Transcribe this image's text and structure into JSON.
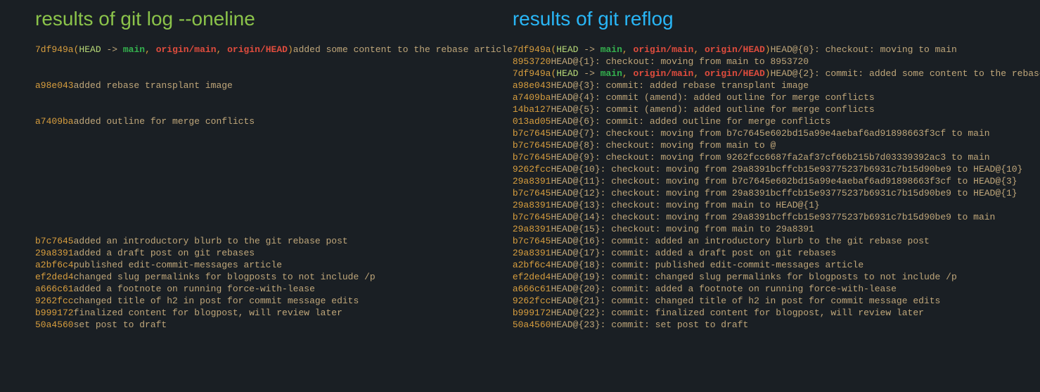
{
  "titles": {
    "left": "results of git log --oneline",
    "right": "results of git reflog"
  },
  "refs_full": {
    "open": "(",
    "head": "HEAD",
    "arrow": " -> ",
    "main": "main",
    "sep": ", ",
    "origin_main": "origin/main",
    "origin_head": "origin/HEAD",
    "close": ")"
  },
  "log": [
    {
      "hash": "7df949a",
      "msg": "added some content to the rebase article",
      "refs": true,
      "gap_after": "gap"
    },
    {
      "hash": "a98e043",
      "msg": "added rebase transplant image",
      "gap_after": "gap"
    },
    {
      "hash": "a7409ba",
      "msg": "added outline for merge conflicts",
      "gap_after": "gap-big"
    },
    {
      "hash": "b7c7645",
      "msg": "added an introductory blurb to the git rebase post"
    },
    {
      "hash": "29a8391",
      "msg": "added a draft post on git rebases"
    },
    {
      "hash": "a2bf6c4",
      "msg": "published edit-commit-messages article"
    },
    {
      "hash": "ef2ded4",
      "msg": "changed slug permalinks for blogposts to not include /p"
    },
    {
      "hash": "a666c61",
      "msg": "added a footnote on running force-with-lease"
    },
    {
      "hash": "9262fcc",
      "msg": "changed title of h2 in post for commit message edits"
    },
    {
      "hash": "b999172",
      "msg": "finalized content for blogpost, will review later"
    },
    {
      "hash": "50a4560",
      "msg": "set post to draft"
    }
  ],
  "reflog": [
    {
      "hash": "7df949a",
      "refs": true,
      "ref": "HEAD@{0}",
      "msg": "checkout: moving to main"
    },
    {
      "hash": "8953720",
      "ref": "HEAD@{1}",
      "msg": "checkout: moving from main to 8953720"
    },
    {
      "hash": "7df949a",
      "refs": true,
      "ref": "HEAD@{2}",
      "msg": "commit: added some content to the rebase article"
    },
    {
      "hash": "a98e043",
      "ref": "HEAD@{3}",
      "msg": "commit: added rebase transplant image"
    },
    {
      "hash": "a7409ba",
      "ref": "HEAD@{4}",
      "msg": "commit (amend): added outline for merge conflicts"
    },
    {
      "hash": "14ba127",
      "ref": "HEAD@{5}",
      "msg": "commit (amend): added outline for merge conflicts"
    },
    {
      "hash": "013ad05",
      "ref": "HEAD@{6}",
      "msg": "commit: added outline for merge conflicts"
    },
    {
      "hash": "b7c7645",
      "ref": "HEAD@{7}",
      "msg": "checkout: moving from b7c7645e602bd15a99e4aebaf6ad91898663f3cf to main"
    },
    {
      "hash": "b7c7645",
      "ref": "HEAD@{8}",
      "msg": "checkout: moving from main to @"
    },
    {
      "hash": "b7c7645",
      "ref": "HEAD@{9}",
      "msg": "checkout: moving from 9262fcc6687fa2af37cf66b215b7d03339392ac3 to main"
    },
    {
      "hash": "9262fcc",
      "ref": "HEAD@{10}",
      "msg": "checkout: moving from 29a8391bcffcb15e93775237b6931c7b15d90be9 to HEAD@{10}"
    },
    {
      "hash": "29a8391",
      "ref": "HEAD@{11}",
      "msg": "checkout: moving from b7c7645e602bd15a99e4aebaf6ad91898663f3cf to HEAD@{3}"
    },
    {
      "hash": "b7c7645",
      "ref": "HEAD@{12}",
      "msg": "checkout: moving from 29a8391bcffcb15e93775237b6931c7b15d90be9 to HEAD@{1}"
    },
    {
      "hash": "29a8391",
      "ref": "HEAD@{13}",
      "msg": "checkout: moving from main to HEAD@{1}"
    },
    {
      "hash": "b7c7645",
      "ref": "HEAD@{14}",
      "msg": "checkout: moving from 29a8391bcffcb15e93775237b6931c7b15d90be9 to main"
    },
    {
      "hash": "29a8391",
      "ref": "HEAD@{15}",
      "msg": "checkout: moving from main to 29a8391"
    },
    {
      "hash": "b7c7645",
      "ref": "HEAD@{16}",
      "msg": "commit: added an introductory blurb to the git rebase post"
    },
    {
      "hash": "29a8391",
      "ref": "HEAD@{17}",
      "msg": "commit: added a draft post on git rebases"
    },
    {
      "hash": "a2bf6c4",
      "ref": "HEAD@{18}",
      "msg": "commit: published edit-commit-messages article"
    },
    {
      "hash": "ef2ded4",
      "ref": "HEAD@{19}",
      "msg": "commit: changed slug permalinks for blogposts to not include /p"
    },
    {
      "hash": "a666c61",
      "ref": "HEAD@{20}",
      "msg": "commit: added a footnote on running force-with-lease"
    },
    {
      "hash": "9262fcc",
      "ref": "HEAD@{21}",
      "msg": "commit: changed title of h2 in post for commit message edits"
    },
    {
      "hash": "b999172",
      "ref": "HEAD@{22}",
      "msg": "commit: finalized content for blogpost, will review later"
    },
    {
      "hash": "50a4560",
      "ref": "HEAD@{23}",
      "msg": "commit: set post to draft"
    }
  ]
}
